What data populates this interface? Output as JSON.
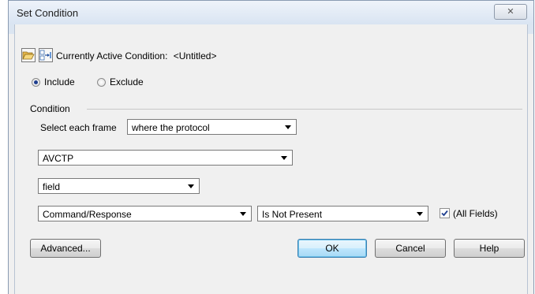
{
  "window": {
    "title": "Set Condition",
    "close_symbol": "✕"
  },
  "toolbar": {
    "open_icon": "folder-open-icon",
    "switch_icon": "switch-condition-icon",
    "active_condition_label": "Currently Active Condition:",
    "active_condition_value": "<Untitled>"
  },
  "mode": {
    "include_label": "Include",
    "exclude_label": "Exclude",
    "selected": "Include"
  },
  "condition": {
    "group_label": "Condition",
    "select_each_frame_label": "Select each frame",
    "frame_filter": "where the protocol",
    "protocol": "AVCTP",
    "property": "field",
    "field": "Command/Response",
    "operator": "Is Not Present",
    "all_fields_label": "(All Fields)",
    "all_fields_checked": true
  },
  "buttons": {
    "advanced": "Advanced...",
    "ok": "OK",
    "cancel": "Cancel",
    "help": "Help"
  }
}
